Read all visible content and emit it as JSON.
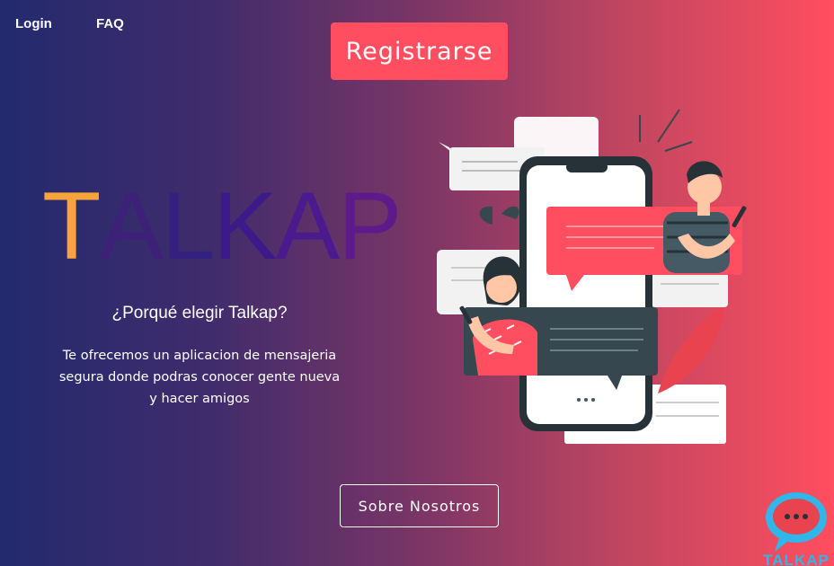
{
  "nav": {
    "login_label": "Login",
    "faq_label": "FAQ"
  },
  "hero": {
    "register_label": "Registrarse",
    "brand_letters": [
      "T",
      "A",
      "L",
      "K",
      "A",
      "P"
    ],
    "why_title": "¿Porqué elegir Talkap?",
    "description": "Te ofrecemos un aplicacion de mensajeria segura donde podras conocer gente nueva y hacer amigos",
    "about_label": "Sobre Nosotros"
  },
  "corner_logo": {
    "text": "TALKAP",
    "icon": "chat-bubble-logo-icon"
  },
  "illustration": {
    "icon": "people-chatting-phone-illustration"
  },
  "colors": {
    "accent": "#ff4e5f",
    "gradient_start": "#232a6e",
    "gradient_end": "#ff4e5f",
    "brand_letter_start": "#fdb132",
    "brand_letter_end": "#3a1a8c",
    "logo_blue": "#30b6e8"
  }
}
